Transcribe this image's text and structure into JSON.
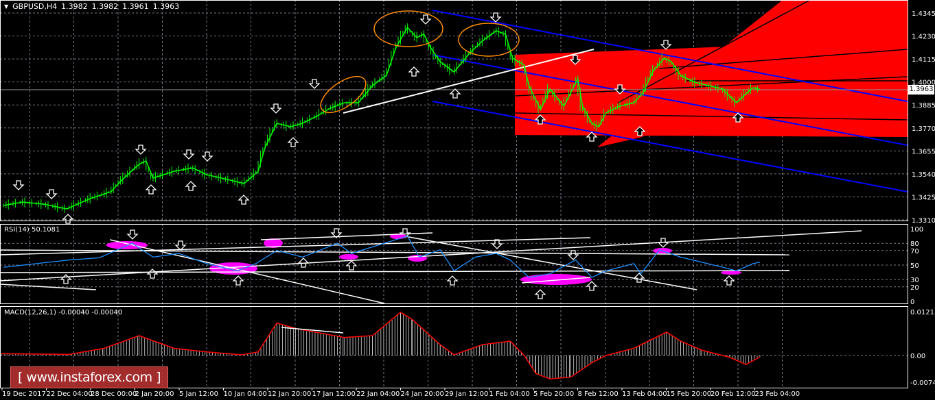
{
  "header": {
    "symbol": "GBPUSD,H4",
    "open": "1.3982",
    "high": "1.3982",
    "low": "1.3961",
    "close": "1.3963"
  },
  "rsi_label": "RSI(14) 50.1081",
  "macd_label": "MACD(12,26,1) -0.00040 -0.00040",
  "watermark": "[ www.instaforex.com ]",
  "current_price": "1.3963",
  "colors": {
    "bullish": "#00ff00",
    "rsi": "#1e90ff",
    "macd_signal": "#ff0000",
    "channel": "#0000ff",
    "fan": "#ff0000",
    "ellipse": "#ff8c00",
    "rsi_zone": "#ff00ff"
  },
  "chart_data": [
    {
      "type": "line",
      "title": "GBPUSD,H4",
      "price_ticks": [
        "1.4345",
        "1.4230",
        "1.4115",
        "1.4000",
        "1.3885",
        "1.3770",
        "1.3655",
        "1.3540",
        "1.3425",
        "1.3310"
      ],
      "ylim": [
        1.331,
        1.4345
      ],
      "time_labels": [
        "19 Dec 2017",
        "22 Dec 04:00",
        "28 Dec 00:00",
        "2 Jan 20:00",
        "5 Jan 12:00",
        "10 Jan 04:00",
        "12 Jan 20:00",
        "17 Jan 12:00",
        "22 Jan 04:00",
        "24 Jan 20:00",
        "29 Jan 12:00",
        "1 Feb 04:00",
        "5 Feb 20:00",
        "8 Feb 12:00",
        "13 Feb 04:00",
        "15 Feb 20:00",
        "20 Feb 12:00",
        "23 Feb 04:00"
      ],
      "series": [
        {
          "name": "close",
          "points": [
            [
              1,
              1.3382
            ],
            [
              9,
              1.3399
            ],
            [
              18,
              1.3389
            ],
            [
              28,
              1.3365
            ],
            [
              38,
              1.3416
            ],
            [
              47,
              1.3451
            ],
            [
              51,
              1.3502
            ],
            [
              59,
              1.3588
            ],
            [
              62,
              1.3605
            ],
            [
              65,
              1.3519
            ],
            [
              74,
              1.3553
            ],
            [
              82,
              1.357
            ],
            [
              88,
              1.3536
            ],
            [
              97,
              1.3512
            ],
            [
              104,
              1.3492
            ],
            [
              110,
              1.3553
            ],
            [
              113,
              1.3673
            ],
            [
              118,
              1.3793
            ],
            [
              124,
              1.3776
            ],
            [
              129,
              1.3793
            ],
            [
              135,
              1.3828
            ],
            [
              141,
              1.3869
            ],
            [
              147,
              1.3896
            ],
            [
              153,
              1.3896
            ],
            [
              159,
              1.3982
            ],
            [
              165,
              1.4033
            ],
            [
              169,
              1.417
            ],
            [
              174,
              1.4273
            ],
            [
              178,
              1.4222
            ],
            [
              181,
              1.4239
            ],
            [
              184,
              1.417
            ],
            [
              188,
              1.4102
            ],
            [
              194,
              1.405
            ],
            [
              200,
              1.4136
            ],
            [
              206,
              1.4204
            ],
            [
              212,
              1.4256
            ],
            [
              216,
              1.4239
            ],
            [
              219,
              1.4119
            ],
            [
              224,
              1.4085
            ],
            [
              226,
              1.3982
            ],
            [
              231,
              1.3862
            ],
            [
              235,
              1.3965
            ],
            [
              241,
              1.3879
            ],
            [
              247,
              1.4016
            ],
            [
              249,
              1.3879
            ],
            [
              253,
              1.3793
            ],
            [
              256,
              1.3776
            ],
            [
              259,
              1.3845
            ],
            [
              265,
              1.3879
            ],
            [
              271,
              1.3896
            ],
            [
              275,
              1.3947
            ],
            [
              279,
              1.405
            ],
            [
              284,
              1.4119
            ],
            [
              287,
              1.4102
            ],
            [
              291,
              1.4033
            ],
            [
              297,
              1.3999
            ],
            [
              303,
              1.3982
            ],
            [
              309,
              1.3965
            ],
            [
              315,
              1.3896
            ],
            [
              318,
              1.393
            ],
            [
              322,
              1.3971
            ],
            [
              325,
              1.3963
            ]
          ]
        }
      ]
    },
    {
      "type": "line",
      "title": "RSI(14)",
      "ticks": [
        100,
        80,
        70,
        50,
        30,
        20,
        0
      ],
      "ylim": [
        0,
        100
      ],
      "series": [
        {
          "name": "RSI",
          "points": [
            [
              1,
              47
            ],
            [
              15,
              52
            ],
            [
              29,
              57
            ],
            [
              42,
              60
            ],
            [
              56,
              80
            ],
            [
              65,
              61
            ],
            [
              76,
              66
            ],
            [
              88,
              52
            ],
            [
              101,
              42
            ],
            [
              109,
              52
            ],
            [
              118,
              70
            ],
            [
              129,
              61
            ],
            [
              144,
              80
            ],
            [
              150,
              66
            ],
            [
              174,
              90
            ],
            [
              179,
              61
            ],
            [
              188,
              71
            ],
            [
              194,
              42
            ],
            [
              203,
              61
            ],
            [
              212,
              66
            ],
            [
              218,
              57
            ],
            [
              226,
              33
            ],
            [
              235,
              38
            ],
            [
              246,
              57
            ],
            [
              253,
              33
            ],
            [
              259,
              42
            ],
            [
              271,
              52
            ],
            [
              274,
              38
            ],
            [
              282,
              71
            ],
            [
              291,
              61
            ],
            [
              309,
              47
            ],
            [
              315,
              42
            ],
            [
              322,
              52
            ],
            [
              325,
              54
            ]
          ]
        }
      ]
    },
    {
      "type": "bar",
      "title": "MACD(12,26,1)",
      "ticks": [
        "0.01215",
        "0.00",
        "-0.0074"
      ],
      "ylim": [
        -0.0074,
        0.01215
      ],
      "series": [
        {
          "name": "MACD",
          "points": [
            [
              0,
              0.0005
            ],
            [
              29,
              0.0003
            ],
            [
              44,
              0.002
            ],
            [
              59,
              0.0055
            ],
            [
              74,
              0.002
            ],
            [
              88,
              0.001
            ],
            [
              103,
              0.0002
            ],
            [
              110,
              0.001
            ],
            [
              118,
              0.009
            ],
            [
              126,
              0.0075
            ],
            [
              147,
              0.005
            ],
            [
              159,
              0.0055
            ],
            [
              171,
              0.012
            ],
            [
              176,
              0.01
            ],
            [
              188,
              0.003
            ],
            [
              194,
              0.0002
            ],
            [
              206,
              0.003
            ],
            [
              218,
              0.004
            ],
            [
              224,
              0.0
            ],
            [
              229,
              -0.005
            ],
            [
              235,
              -0.0065
            ],
            [
              244,
              -0.006
            ],
            [
              253,
              -0.002
            ],
            [
              259,
              0.0
            ],
            [
              271,
              0.002
            ],
            [
              285,
              0.0065
            ],
            [
              291,
              0.004
            ],
            [
              300,
              0.0015
            ],
            [
              312,
              -0.0005
            ],
            [
              319,
              -0.0025
            ],
            [
              325,
              -0.0004
            ]
          ]
        }
      ]
    }
  ]
}
